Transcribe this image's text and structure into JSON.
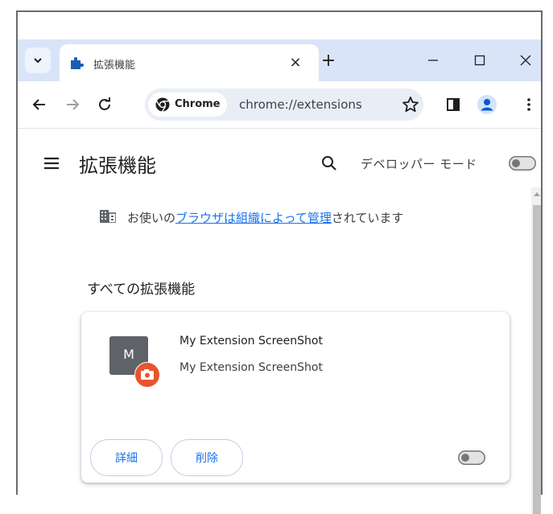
{
  "tab": {
    "title": "拡張機能",
    "close_glyph": "×",
    "new_tab_glyph": "+"
  },
  "toolbar": {
    "chip_label": "Chrome",
    "url": "chrome://extensions"
  },
  "header": {
    "title": "拡張機能",
    "devmode_label": "デベロッパー モード"
  },
  "managed": {
    "prefix": "お使いの",
    "link": "ブラウザは組織によって管理",
    "suffix": "されています"
  },
  "section_title": "すべての拡張機能",
  "extension": {
    "icon_letter": "M",
    "name": "My Extension ScreenShot",
    "description": "My Extension ScreenShot",
    "details_label": "詳細",
    "remove_label": "削除",
    "enabled": false
  },
  "developer_mode_enabled": false,
  "colors": {
    "accent": "#1a73e8",
    "tabstrip": "#d9e4f8",
    "badge": "#e8542c",
    "extension_icon_bg": "#5f6368"
  }
}
